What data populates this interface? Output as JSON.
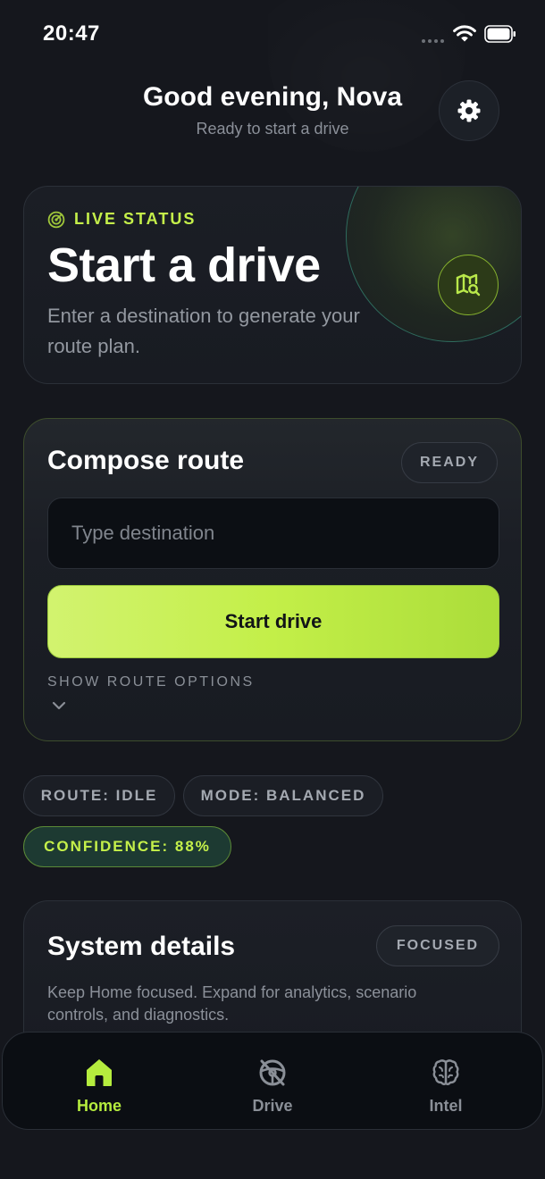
{
  "status_bar": {
    "time": "20:47"
  },
  "header": {
    "title": "Good evening, Nova",
    "subtitle": "Ready to start a drive"
  },
  "live_status": {
    "label": "LIVE STATUS",
    "title": "Start a drive",
    "description": "Enter a destination to generate your route plan."
  },
  "compose": {
    "title": "Compose route",
    "badge": "READY",
    "destination_placeholder": "Type destination",
    "destination_value": "",
    "start_label": "Start drive",
    "options_label": "SHOW ROUTE OPTIONS"
  },
  "chips": {
    "route": "ROUTE: IDLE",
    "mode": "MODE: BALANCED",
    "confidence": "CONFIDENCE: 88%"
  },
  "system": {
    "title": "System details",
    "badge": "FOCUSED",
    "description": "Keep Home focused. Expand for analytics, scenario controls, and diagnostics."
  },
  "nav": {
    "items": [
      {
        "label": "Home",
        "icon": "home-icon",
        "active": true
      },
      {
        "label": "Drive",
        "icon": "steering-off-icon",
        "active": false
      },
      {
        "label": "Intel",
        "icon": "brain-icon",
        "active": false
      }
    ]
  },
  "colors": {
    "accent": "#c5f04a",
    "background": "#15171d",
    "card": "#1b1e25",
    "nav_background": "#0b0e13"
  }
}
